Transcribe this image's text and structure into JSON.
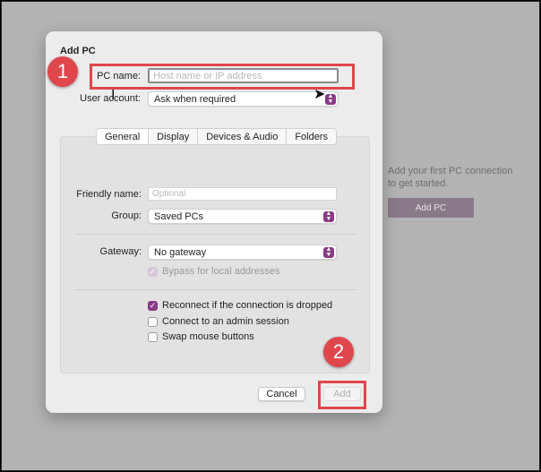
{
  "background": {
    "message": "Add your first PC connection to get started.",
    "add_pc_button": "Add PC"
  },
  "dialog": {
    "title": "Add PC",
    "pc_name": {
      "label": "PC name:",
      "value": "",
      "placeholder": "Host name or IP address"
    },
    "user_account": {
      "label": "User account:",
      "value": "Ask when required"
    },
    "tabs": [
      {
        "label": "General",
        "active": true
      },
      {
        "label": "Display",
        "active": false
      },
      {
        "label": "Devices & Audio",
        "active": false
      },
      {
        "label": "Folders",
        "active": false
      }
    ],
    "friendly_name": {
      "label": "Friendly name:",
      "value": "",
      "placeholder": "Optional"
    },
    "group": {
      "label": "Group:",
      "value": "Saved PCs"
    },
    "gateway": {
      "label": "Gateway:",
      "value": "No gateway"
    },
    "bypass_local": {
      "label": "Bypass for local addresses",
      "checked": true,
      "enabled": false
    },
    "reconnect": {
      "label": "Reconnect if the connection is dropped",
      "checked": true
    },
    "admin_session": {
      "label": "Connect to an admin session",
      "checked": false
    },
    "swap_mouse": {
      "label": "Swap mouse buttons",
      "checked": false
    },
    "cancel_label": "Cancel",
    "add_label": "Add"
  },
  "annotations": {
    "step1": "1",
    "step2": "2"
  },
  "colors": {
    "accent": "#8a3a86",
    "annotation": "#e0474c"
  }
}
